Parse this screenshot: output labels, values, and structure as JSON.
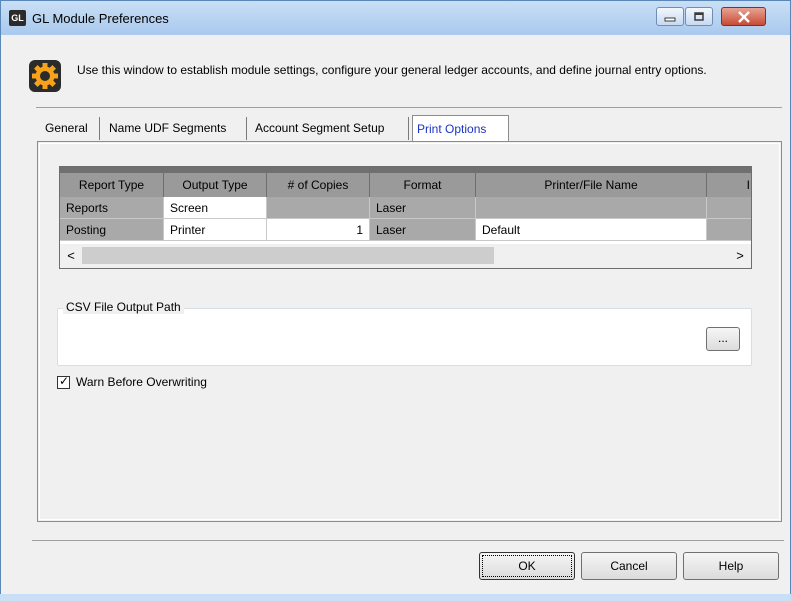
{
  "window": {
    "app_badge": "GL",
    "title": "GL Module Preferences",
    "controls": {
      "minimize_icon": "minimize-icon",
      "maximize_icon": "maximize-icon",
      "close_icon": "close-icon"
    }
  },
  "header": {
    "icon": "settings-gear-icon",
    "description": "Use this window to establish module settings, configure your general ledger accounts, and define journal entry options."
  },
  "tabs": [
    {
      "label": "General",
      "active": false
    },
    {
      "label": "Name UDF Segments",
      "active": false
    },
    {
      "label": "Account Segment Setup",
      "active": false
    },
    {
      "label": "Print Options",
      "active": true
    }
  ],
  "grid": {
    "columns": [
      "Report Type",
      "Output Type",
      "# of Copies",
      "Format",
      "Printer/File Name",
      "I"
    ],
    "rows": [
      {
        "report_type": "Reports",
        "output_type": "Screen",
        "copies": "",
        "format": "Laser",
        "printer": "",
        "extra": ""
      },
      {
        "report_type": "Posting",
        "output_type": "Printer",
        "copies": "1",
        "format": "Laser",
        "printer": "Default",
        "extra": ""
      }
    ],
    "scroll_left": "<",
    "scroll_right": ">"
  },
  "csv": {
    "group_label": "CSV File Output Path",
    "path_value": "",
    "browse_label": "..."
  },
  "warn": {
    "label": "Warn Before Overwriting",
    "checked": true,
    "check_glyph": "✓"
  },
  "buttons": {
    "ok": "OK",
    "cancel": "Cancel",
    "help": "Help"
  },
  "colors": {
    "title_bar": "#c9dff5",
    "active_tab_text": "#1a33c4",
    "close_button": "#c74b35",
    "icon_orange": "#f7a21b"
  }
}
